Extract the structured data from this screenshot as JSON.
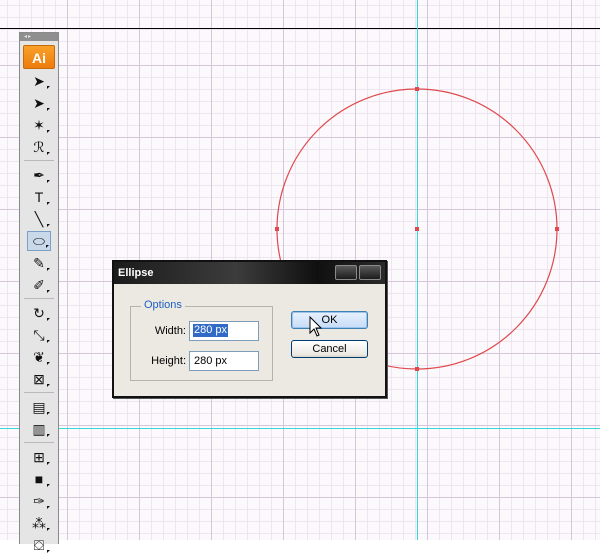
{
  "app": {
    "logo_text": "Ai",
    "accent_color": "#f08a12",
    "guide_color": "#35d9dc",
    "shape_stroke_color": "#e0484c"
  },
  "toolbox": {
    "grip": "◂▸",
    "tools": [
      {
        "name": "selection-tool",
        "icon": "selection-arrow-icon",
        "glyph": "➤"
      },
      {
        "name": "direct-selection-tool",
        "icon": "direct-selection-icon",
        "glyph": "➤"
      },
      {
        "name": "magic-wand-tool",
        "icon": "magic-wand-icon",
        "glyph": "✶"
      },
      {
        "name": "lasso-tool",
        "icon": "lasso-icon",
        "glyph": "ℛ"
      },
      {
        "name": "pen-tool",
        "icon": "pen-icon",
        "glyph": "✒"
      },
      {
        "name": "type-tool",
        "icon": "type-icon",
        "glyph": "T"
      },
      {
        "name": "line-segment-tool",
        "icon": "line-icon",
        "glyph": "╲"
      },
      {
        "name": "ellipse-tool",
        "icon": "ellipse-icon",
        "glyph": "⬭",
        "active": true
      },
      {
        "name": "paintbrush-tool",
        "icon": "paintbrush-icon",
        "glyph": "✎"
      },
      {
        "name": "pencil-tool",
        "icon": "pencil-icon",
        "glyph": "✐"
      },
      {
        "name": "rotate-tool",
        "icon": "rotate-icon",
        "glyph": "↻"
      },
      {
        "name": "scale-tool",
        "icon": "scale-icon",
        "glyph": "⤡"
      },
      {
        "name": "warp-tool",
        "icon": "warp-icon",
        "glyph": "❦"
      },
      {
        "name": "free-transform-tool",
        "icon": "free-transform-icon",
        "glyph": "⊠"
      },
      {
        "name": "symbol-sprayer-tool",
        "icon": "symbol-sprayer-icon",
        "glyph": "▤"
      },
      {
        "name": "column-graph-tool",
        "icon": "column-graph-icon",
        "glyph": "▥"
      },
      {
        "name": "mesh-tool",
        "icon": "mesh-icon",
        "glyph": "⊞"
      },
      {
        "name": "gradient-tool",
        "icon": "gradient-icon",
        "glyph": "■"
      },
      {
        "name": "eyedropper-tool",
        "icon": "eyedropper-icon",
        "glyph": "✑"
      },
      {
        "name": "blend-tool",
        "icon": "blend-icon",
        "glyph": "⁂"
      },
      {
        "name": "live-paint-bucket-tool",
        "icon": "paint-bucket-icon",
        "glyph": "⛋"
      }
    ]
  },
  "dialog": {
    "title": "Ellipse",
    "group_label": "Options",
    "width_label": "Width:",
    "width_value": "280 px",
    "height_label": "Height:",
    "height_value": "280 px",
    "ok_label": "OK",
    "cancel_label": "Cancel"
  }
}
